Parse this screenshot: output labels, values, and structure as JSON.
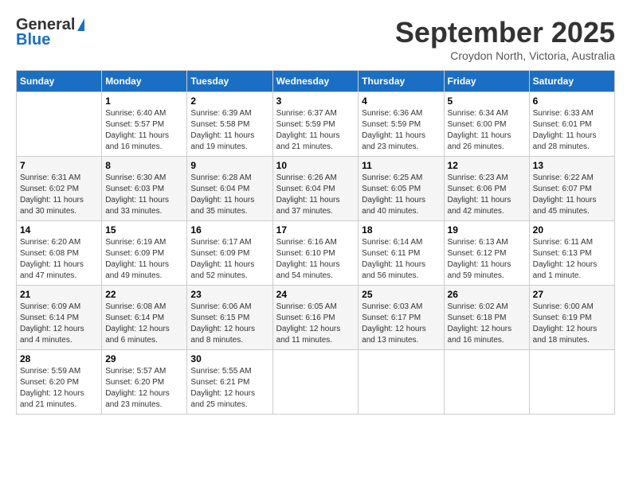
{
  "logo": {
    "line1": "General",
    "line2": "Blue"
  },
  "title": "September 2025",
  "location": "Croydon North, Victoria, Australia",
  "days_of_week": [
    "Sunday",
    "Monday",
    "Tuesday",
    "Wednesday",
    "Thursday",
    "Friday",
    "Saturday"
  ],
  "weeks": [
    [
      {
        "day": "",
        "info": ""
      },
      {
        "day": "1",
        "info": "Sunrise: 6:40 AM\nSunset: 5:57 PM\nDaylight: 11 hours and 16 minutes."
      },
      {
        "day": "2",
        "info": "Sunrise: 6:39 AM\nSunset: 5:58 PM\nDaylight: 11 hours and 19 minutes."
      },
      {
        "day": "3",
        "info": "Sunrise: 6:37 AM\nSunset: 5:59 PM\nDaylight: 11 hours and 21 minutes."
      },
      {
        "day": "4",
        "info": "Sunrise: 6:36 AM\nSunset: 5:59 PM\nDaylight: 11 hours and 23 minutes."
      },
      {
        "day": "5",
        "info": "Sunrise: 6:34 AM\nSunset: 6:00 PM\nDaylight: 11 hours and 26 minutes."
      },
      {
        "day": "6",
        "info": "Sunrise: 6:33 AM\nSunset: 6:01 PM\nDaylight: 11 hours and 28 minutes."
      }
    ],
    [
      {
        "day": "7",
        "info": "Sunrise: 6:31 AM\nSunset: 6:02 PM\nDaylight: 11 hours and 30 minutes."
      },
      {
        "day": "8",
        "info": "Sunrise: 6:30 AM\nSunset: 6:03 PM\nDaylight: 11 hours and 33 minutes."
      },
      {
        "day": "9",
        "info": "Sunrise: 6:28 AM\nSunset: 6:04 PM\nDaylight: 11 hours and 35 minutes."
      },
      {
        "day": "10",
        "info": "Sunrise: 6:26 AM\nSunset: 6:04 PM\nDaylight: 11 hours and 37 minutes."
      },
      {
        "day": "11",
        "info": "Sunrise: 6:25 AM\nSunset: 6:05 PM\nDaylight: 11 hours and 40 minutes."
      },
      {
        "day": "12",
        "info": "Sunrise: 6:23 AM\nSunset: 6:06 PM\nDaylight: 11 hours and 42 minutes."
      },
      {
        "day": "13",
        "info": "Sunrise: 6:22 AM\nSunset: 6:07 PM\nDaylight: 11 hours and 45 minutes."
      }
    ],
    [
      {
        "day": "14",
        "info": "Sunrise: 6:20 AM\nSunset: 6:08 PM\nDaylight: 11 hours and 47 minutes."
      },
      {
        "day": "15",
        "info": "Sunrise: 6:19 AM\nSunset: 6:09 PM\nDaylight: 11 hours and 49 minutes."
      },
      {
        "day": "16",
        "info": "Sunrise: 6:17 AM\nSunset: 6:09 PM\nDaylight: 11 hours and 52 minutes."
      },
      {
        "day": "17",
        "info": "Sunrise: 6:16 AM\nSunset: 6:10 PM\nDaylight: 11 hours and 54 minutes."
      },
      {
        "day": "18",
        "info": "Sunrise: 6:14 AM\nSunset: 6:11 PM\nDaylight: 11 hours and 56 minutes."
      },
      {
        "day": "19",
        "info": "Sunrise: 6:13 AM\nSunset: 6:12 PM\nDaylight: 11 hours and 59 minutes."
      },
      {
        "day": "20",
        "info": "Sunrise: 6:11 AM\nSunset: 6:13 PM\nDaylight: 12 hours and 1 minute."
      }
    ],
    [
      {
        "day": "21",
        "info": "Sunrise: 6:09 AM\nSunset: 6:14 PM\nDaylight: 12 hours and 4 minutes."
      },
      {
        "day": "22",
        "info": "Sunrise: 6:08 AM\nSunset: 6:14 PM\nDaylight: 12 hours and 6 minutes."
      },
      {
        "day": "23",
        "info": "Sunrise: 6:06 AM\nSunset: 6:15 PM\nDaylight: 12 hours and 8 minutes."
      },
      {
        "day": "24",
        "info": "Sunrise: 6:05 AM\nSunset: 6:16 PM\nDaylight: 12 hours and 11 minutes."
      },
      {
        "day": "25",
        "info": "Sunrise: 6:03 AM\nSunset: 6:17 PM\nDaylight: 12 hours and 13 minutes."
      },
      {
        "day": "26",
        "info": "Sunrise: 6:02 AM\nSunset: 6:18 PM\nDaylight: 12 hours and 16 minutes."
      },
      {
        "day": "27",
        "info": "Sunrise: 6:00 AM\nSunset: 6:19 PM\nDaylight: 12 hours and 18 minutes."
      }
    ],
    [
      {
        "day": "28",
        "info": "Sunrise: 5:59 AM\nSunset: 6:20 PM\nDaylight: 12 hours and 21 minutes."
      },
      {
        "day": "29",
        "info": "Sunrise: 5:57 AM\nSunset: 6:20 PM\nDaylight: 12 hours and 23 minutes."
      },
      {
        "day": "30",
        "info": "Sunrise: 5:55 AM\nSunset: 6:21 PM\nDaylight: 12 hours and 25 minutes."
      },
      {
        "day": "",
        "info": ""
      },
      {
        "day": "",
        "info": ""
      },
      {
        "day": "",
        "info": ""
      },
      {
        "day": "",
        "info": ""
      }
    ]
  ]
}
